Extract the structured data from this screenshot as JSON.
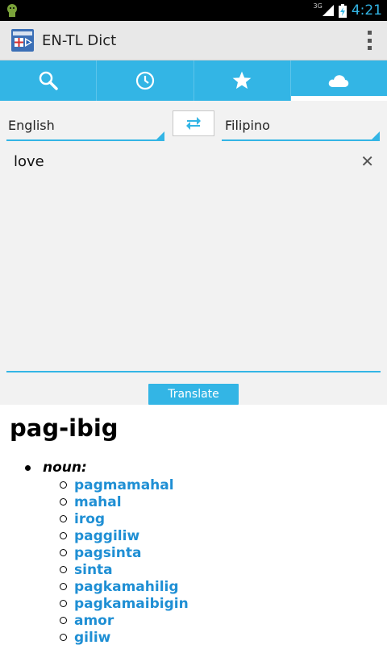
{
  "status": {
    "network": "3G",
    "time": "4:21"
  },
  "app": {
    "title": "EN-TL Dict"
  },
  "tabs": [
    {
      "icon": "search-icon",
      "selected": false
    },
    {
      "icon": "clock-icon",
      "selected": false
    },
    {
      "icon": "star-icon",
      "selected": false
    },
    {
      "icon": "cloud-icon",
      "selected": true
    }
  ],
  "translate": {
    "source_language": "English",
    "target_language": "Filipino",
    "input_text": "love",
    "button_label": "Translate"
  },
  "result": {
    "word": "pag-ibig",
    "part_of_speech": "noun:",
    "translations": [
      "pagmamahal",
      "mahal",
      "irog",
      "paggiliw",
      "pagsinta",
      "sinta",
      "pagkamahilig",
      "pagkamaibigin",
      "amor",
      "giliw"
    ]
  },
  "colors": {
    "accent": "#33b5e5",
    "link": "#1f8fd4"
  }
}
